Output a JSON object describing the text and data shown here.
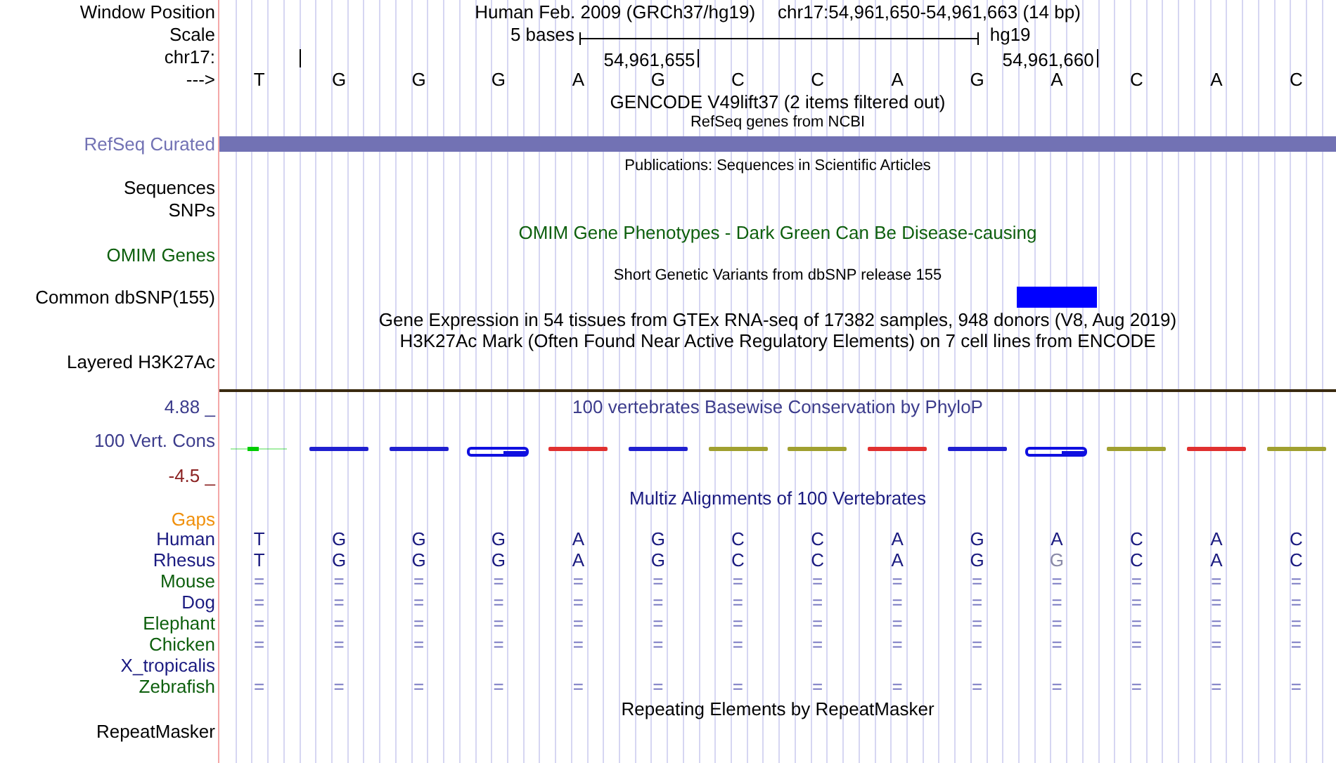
{
  "header": {
    "position_label": "Window Position",
    "assembly": "Human Feb. 2009 (GRCh37/hg19)",
    "position": "chr17:54,961,650-54,961,663 (14 bp)",
    "scale_label": "Scale",
    "scale_text": "5 bases",
    "scale_db": "hg19",
    "chrom_label": "chr17:",
    "coord_ticks": [
      "54,961,655",
      "54,961,660"
    ],
    "strand_label": "--->",
    "bases": [
      "T",
      "G",
      "G",
      "G",
      "A",
      "G",
      "C",
      "C",
      "A",
      "G",
      "A",
      "C",
      "A",
      "C"
    ]
  },
  "tracks": [
    {
      "kind": "title",
      "title": "GENCODE V49lift37 (2 items filtered out)"
    },
    {
      "kind": "subtitle",
      "title": "RefSeq genes from NCBI"
    },
    {
      "kind": "bar",
      "label": "RefSeq Curated",
      "color": "#7272b4"
    },
    {
      "kind": "subtitle",
      "title": "Publications: Sequences in Scientific Articles"
    },
    {
      "kind": "label",
      "label": "Sequences"
    },
    {
      "kind": "label",
      "label": "SNPs"
    },
    {
      "kind": "title",
      "title": "OMIM Gene Phenotypes - Dark Green Can Be Disease-causing",
      "color": "#0d5f0d"
    },
    {
      "kind": "label",
      "label": "OMIM Genes",
      "color": "#0d5f0d"
    },
    {
      "kind": "subtitle",
      "title": "Short Genetic Variants from dbSNP release 155"
    },
    {
      "kind": "feature",
      "label": "Common dbSNP(155)",
      "covered": [
        false,
        false,
        false,
        false,
        false,
        false,
        false,
        false,
        false,
        false,
        true,
        false,
        false,
        false
      ]
    },
    {
      "kind": "title",
      "title": "Gene Expression in 54 tissues from GTEx RNA-seq of 17382 samples, 948 donors (V8, Aug 2019)"
    },
    {
      "kind": "title",
      "title": "H3K27Ac Mark (Often Found Near Active Regulatory Elements) on 7 cell lines from ENCODE"
    },
    {
      "kind": "label",
      "label": "Layered H3K27Ac"
    },
    {
      "kind": "divider"
    },
    {
      "kind": "axis",
      "label": "4.88 _",
      "title": "100 vertebrates Basewise Conservation by PhyloP",
      "color": "#3c3c8c"
    },
    {
      "kind": "wiggle",
      "label": "100 Vert. Cons",
      "color": "#3c3c8c",
      "glyphs": [
        {
          "kind": "dot",
          "color": "#00cc00"
        },
        {
          "kind": "line",
          "color": "#2020d0"
        },
        {
          "kind": "line",
          "color": "#2020d0"
        },
        {
          "kind": "blob",
          "color": "#1010e0"
        },
        {
          "kind": "line",
          "color": "#e03030"
        },
        {
          "kind": "line",
          "color": "#2020d0"
        },
        {
          "kind": "line",
          "color": "#a0a030"
        },
        {
          "kind": "line",
          "color": "#a0a030"
        },
        {
          "kind": "line",
          "color": "#e03030"
        },
        {
          "kind": "line",
          "color": "#2020d0"
        },
        {
          "kind": "blob",
          "color": "#1010e0"
        },
        {
          "kind": "line",
          "color": "#a0a030"
        },
        {
          "kind": "line",
          "color": "#e03030"
        },
        {
          "kind": "line",
          "color": "#a0a030"
        }
      ]
    },
    {
      "kind": "label",
      "label": "-4.5 _",
      "color": "#8b2222"
    },
    {
      "kind": "title",
      "title": "Multiz Alignments of 100 Vertebrates",
      "color": "#1a1a80"
    },
    {
      "kind": "label",
      "label": "Gaps",
      "color": "#f0900c"
    },
    {
      "kind": "alignment",
      "label": "Human",
      "color": "#1a1a80",
      "cells": [
        {
          "base": "T",
          "differs": false
        },
        {
          "base": "G",
          "differs": false
        },
        {
          "base": "G",
          "differs": false
        },
        {
          "base": "G",
          "differs": false
        },
        {
          "base": "A",
          "differs": false
        },
        {
          "base": "G",
          "differs": false
        },
        {
          "base": "C",
          "differs": false
        },
        {
          "base": "C",
          "differs": false
        },
        {
          "base": "A",
          "differs": false
        },
        {
          "base": "G",
          "differs": false
        },
        {
          "base": "A",
          "differs": false
        },
        {
          "base": "C",
          "differs": false
        },
        {
          "base": "A",
          "differs": false
        },
        {
          "base": "C",
          "differs": false
        }
      ]
    },
    {
      "kind": "alignment",
      "label": "Rhesus",
      "color": "#1a1a80",
      "cells": [
        {
          "base": "T",
          "differs": false
        },
        {
          "base": "G",
          "differs": false
        },
        {
          "base": "G",
          "differs": false
        },
        {
          "base": "G",
          "differs": false
        },
        {
          "base": "A",
          "differs": false
        },
        {
          "base": "G",
          "differs": false
        },
        {
          "base": "C",
          "differs": false
        },
        {
          "base": "C",
          "differs": false
        },
        {
          "base": "A",
          "differs": false
        },
        {
          "base": "G",
          "differs": false
        },
        {
          "base": "G",
          "differs": true
        },
        {
          "base": "C",
          "differs": false
        },
        {
          "base": "A",
          "differs": false
        },
        {
          "base": "C",
          "differs": false
        }
      ]
    },
    {
      "kind": "alignment",
      "label": "Mouse",
      "color": "#0d5f0d",
      "cells": [
        {
          "base": "=",
          "differs": false
        },
        {
          "base": "=",
          "differs": false
        },
        {
          "base": "=",
          "differs": false
        },
        {
          "base": "=",
          "differs": false
        },
        {
          "base": "=",
          "differs": false
        },
        {
          "base": "=",
          "differs": false
        },
        {
          "base": "=",
          "differs": false
        },
        {
          "base": "=",
          "differs": false
        },
        {
          "base": "=",
          "differs": false
        },
        {
          "base": "=",
          "differs": false
        },
        {
          "base": "=",
          "differs": false
        },
        {
          "base": "=",
          "differs": false
        },
        {
          "base": "=",
          "differs": false
        },
        {
          "base": "=",
          "differs": false
        }
      ]
    },
    {
      "kind": "alignment",
      "label": "Dog",
      "color": "#1a1a80",
      "cells": [
        {
          "base": "=",
          "differs": false
        },
        {
          "base": "=",
          "differs": false
        },
        {
          "base": "=",
          "differs": false
        },
        {
          "base": "=",
          "differs": false
        },
        {
          "base": "=",
          "differs": false
        },
        {
          "base": "=",
          "differs": false
        },
        {
          "base": "=",
          "differs": false
        },
        {
          "base": "=",
          "differs": false
        },
        {
          "base": "=",
          "differs": false
        },
        {
          "base": "=",
          "differs": false
        },
        {
          "base": "=",
          "differs": false
        },
        {
          "base": "=",
          "differs": false
        },
        {
          "base": "=",
          "differs": false
        },
        {
          "base": "=",
          "differs": false
        }
      ]
    },
    {
      "kind": "alignment",
      "label": "Elephant",
      "color": "#0d5f0d",
      "cells": [
        {
          "base": "=",
          "differs": false
        },
        {
          "base": "=",
          "differs": false
        },
        {
          "base": "=",
          "differs": false
        },
        {
          "base": "=",
          "differs": false
        },
        {
          "base": "=",
          "differs": false
        },
        {
          "base": "=",
          "differs": false
        },
        {
          "base": "=",
          "differs": false
        },
        {
          "base": "=",
          "differs": false
        },
        {
          "base": "=",
          "differs": false
        },
        {
          "base": "=",
          "differs": false
        },
        {
          "base": "=",
          "differs": false
        },
        {
          "base": "=",
          "differs": false
        },
        {
          "base": "=",
          "differs": false
        },
        {
          "base": "=",
          "differs": false
        }
      ]
    },
    {
      "kind": "alignment",
      "label": "Chicken",
      "color": "#0d5f0d",
      "cells": [
        {
          "base": "=",
          "differs": false
        },
        {
          "base": "=",
          "differs": false
        },
        {
          "base": "=",
          "differs": false
        },
        {
          "base": "=",
          "differs": false
        },
        {
          "base": "=",
          "differs": false
        },
        {
          "base": "=",
          "differs": false
        },
        {
          "base": "=",
          "differs": false
        },
        {
          "base": "=",
          "differs": false
        },
        {
          "base": "=",
          "differs": false
        },
        {
          "base": "=",
          "differs": false
        },
        {
          "base": "=",
          "differs": false
        },
        {
          "base": "=",
          "differs": false
        },
        {
          "base": "=",
          "differs": false
        },
        {
          "base": "=",
          "differs": false
        }
      ]
    },
    {
      "kind": "alignment",
      "label": "X_tropicalis",
      "color": "#1a1a80"
    },
    {
      "kind": "alignment",
      "label": "Zebrafish",
      "color": "#0d5f0d",
      "cells": [
        {
          "base": "=",
          "differs": false
        },
        {
          "base": "=",
          "differs": false
        },
        {
          "base": "=",
          "differs": false
        },
        {
          "base": "=",
          "differs": false
        },
        {
          "base": "=",
          "differs": false
        },
        {
          "base": "=",
          "differs": false
        },
        {
          "base": "=",
          "differs": false
        },
        {
          "base": "=",
          "differs": false
        },
        {
          "base": "=",
          "differs": false
        },
        {
          "base": "=",
          "differs": false
        },
        {
          "base": "=",
          "differs": false
        },
        {
          "base": "=",
          "differs": false
        },
        {
          "base": "=",
          "differs": false
        },
        {
          "base": "=",
          "differs": false
        }
      ]
    },
    {
      "kind": "title",
      "title": "Repeating Elements by RepeatMasker"
    },
    {
      "kind": "label",
      "label": "RepeatMasker"
    }
  ]
}
